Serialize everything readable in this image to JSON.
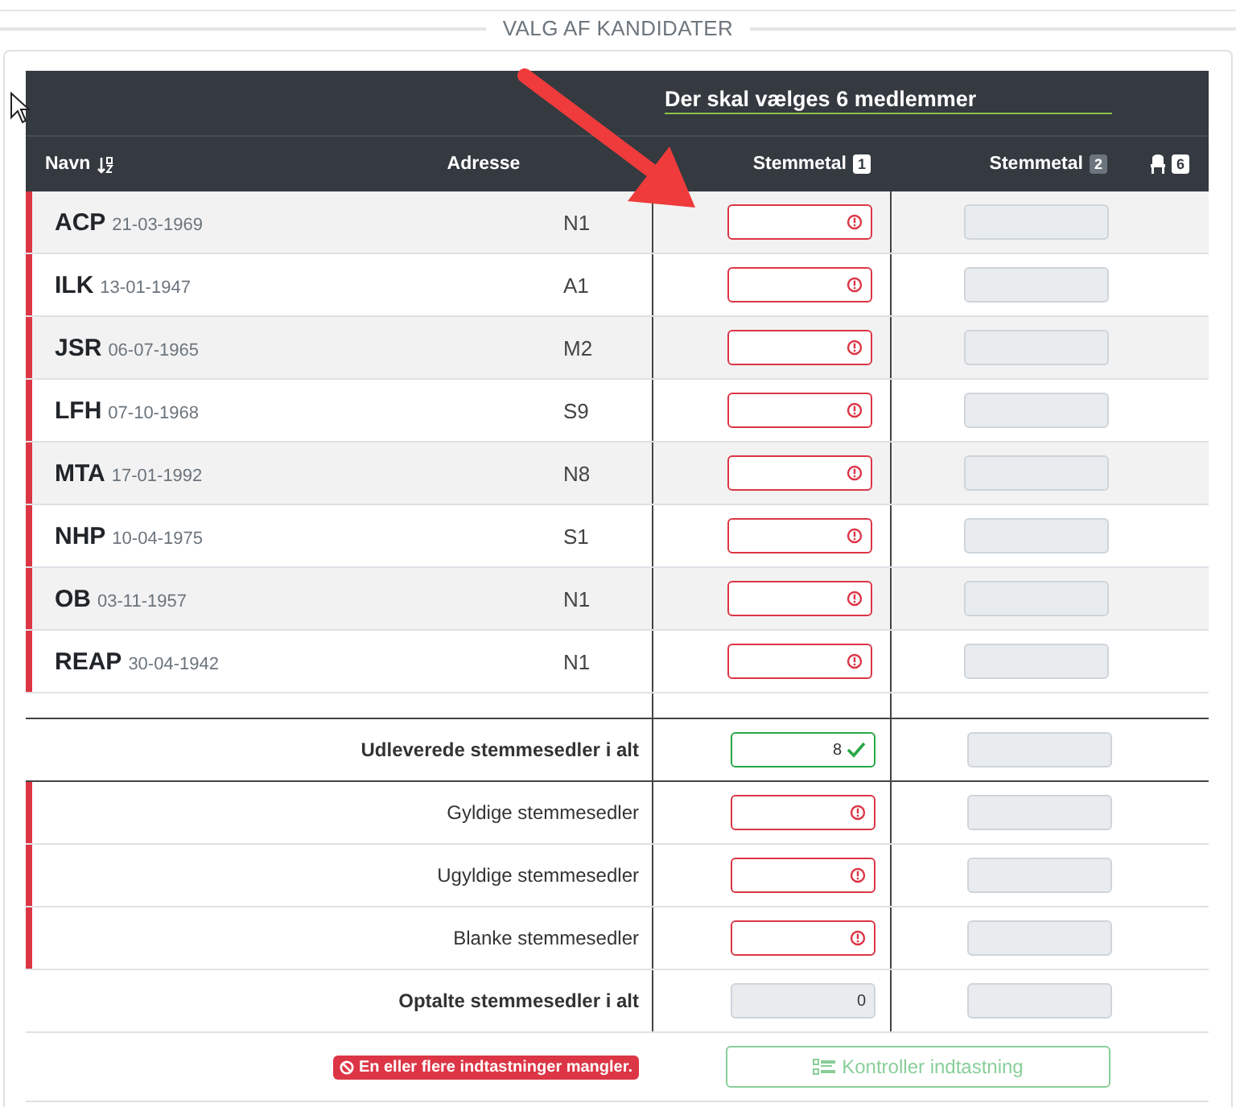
{
  "section_title": "VALG AF KANDIDATER",
  "table": {
    "title": "Der skal vælges 6 medlemmer",
    "columns": [
      {
        "kind": "sort",
        "label": "Navn"
      },
      {
        "kind": "plain",
        "label": "Adresse"
      },
      {
        "kind": "numbered",
        "label": "Stemmetal",
        "badge": "1",
        "active": true
      },
      {
        "kind": "numbered",
        "label": "Stemmetal",
        "badge": "2",
        "active": false
      },
      {
        "kind": "seats",
        "badge": "6"
      }
    ],
    "candidates": [
      {
        "name": "ACP",
        "born": "21-03-1969",
        "address": "N1",
        "flagged": true,
        "count_1": {
          "kind": "invalid"
        },
        "count_2": {
          "kind": "readonly"
        }
      },
      {
        "name": "ILK",
        "born": "13-01-1947",
        "address": "A1",
        "flagged": true,
        "count_1": {
          "kind": "invalid"
        },
        "count_2": {
          "kind": "readonly"
        }
      },
      {
        "name": "JSR",
        "born": "06-07-1965",
        "address": "M2",
        "flagged": true,
        "count_1": {
          "kind": "invalid"
        },
        "count_2": {
          "kind": "readonly"
        }
      },
      {
        "name": "LFH",
        "born": "07-10-1968",
        "address": "S9",
        "flagged": true,
        "count_1": {
          "kind": "invalid"
        },
        "count_2": {
          "kind": "readonly"
        }
      },
      {
        "name": "MTA",
        "born": "17-01-1992",
        "address": "N8",
        "flagged": true,
        "count_1": {
          "kind": "invalid"
        },
        "count_2": {
          "kind": "readonly"
        }
      },
      {
        "name": "NHP",
        "born": "10-04-1975",
        "address": "S1",
        "flagged": true,
        "count_1": {
          "kind": "invalid"
        },
        "count_2": {
          "kind": "readonly"
        }
      },
      {
        "name": "OB",
        "born": "03-11-1957",
        "address": "N1",
        "flagged": true,
        "count_1": {
          "kind": "invalid"
        },
        "count_2": {
          "kind": "readonly"
        }
      },
      {
        "name": "REAP",
        "born": "30-04-1942",
        "address": "N1",
        "flagged": true,
        "count_1": {
          "kind": "invalid"
        },
        "count_2": {
          "kind": "readonly"
        }
      }
    ],
    "summary": [
      {
        "label": "Udleverede stemmesedler i alt",
        "bold": true,
        "flagged": false,
        "count_1": {
          "value": "8",
          "kind": "valid"
        },
        "count_2": {
          "kind": "readonly"
        }
      },
      {
        "label": "Gyldige stemmesedler",
        "bold": false,
        "flagged": true,
        "count_1": {
          "kind": "invalid"
        },
        "count_2": {
          "kind": "readonly"
        }
      },
      {
        "label": "Ugyldige stemmesedler",
        "bold": false,
        "flagged": true,
        "count_1": {
          "kind": "invalid"
        },
        "count_2": {
          "kind": "readonly"
        }
      },
      {
        "label": "Blanke stemmesedler",
        "bold": false,
        "flagged": true,
        "count_1": {
          "kind": "invalid"
        },
        "count_2": {
          "kind": "readonly"
        }
      },
      {
        "label": "Optalte stemmesedler i alt",
        "bold": true,
        "flagged": false,
        "count_1": {
          "value": "0",
          "kind": "readonly"
        },
        "count_2": {
          "kind": "readonly"
        }
      }
    ]
  },
  "footer": {
    "message": "En eller flere indtastninger mangler.",
    "button": {
      "label": "Kontroller indtastning",
      "disabled": true
    }
  }
}
